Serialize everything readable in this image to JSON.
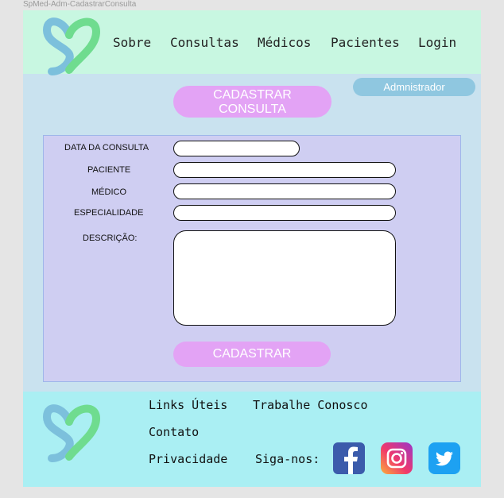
{
  "frame_label": "SpMed-Adm-CadastrarConsulta",
  "header": {
    "nav": [
      "Sobre",
      "Consultas",
      "Médicos",
      "Pacientes",
      "Login"
    ]
  },
  "user_role_badge": "Admnistrador",
  "page_title_line1": "CADASTRAR",
  "page_title_line2": "CONSULTA",
  "form": {
    "fields": {
      "date": {
        "label": "DATA DA CONSULTA",
        "value": ""
      },
      "patient": {
        "label": "PACIENTE",
        "value": ""
      },
      "doctor": {
        "label": "MÉDICO",
        "value": ""
      },
      "specialty": {
        "label": "ESPECIALIDADE",
        "value": ""
      },
      "description": {
        "label": "DESCRIÇÃO:",
        "value": ""
      }
    },
    "submit_label": "CADASTRAR"
  },
  "footer": {
    "links": {
      "useful": "Links Úteis",
      "careers": "Trabalhe Conosco",
      "contact": "Contato",
      "privacy": "Privacidade"
    },
    "follow_label": "Siga-nos:",
    "social": [
      "facebook-icon",
      "instagram-icon",
      "twitter-icon"
    ]
  },
  "colors": {
    "header_bg": "#c8f7e1",
    "body_bg": "#c9e2ef",
    "form_bg": "#cfcef2",
    "accent_pink": "#e3a3f5",
    "badge_blue": "#8fc7e0",
    "footer_bg": "#aaeff3",
    "logo_green": "#6fdc8f",
    "logo_blue": "#7cc0dc"
  }
}
